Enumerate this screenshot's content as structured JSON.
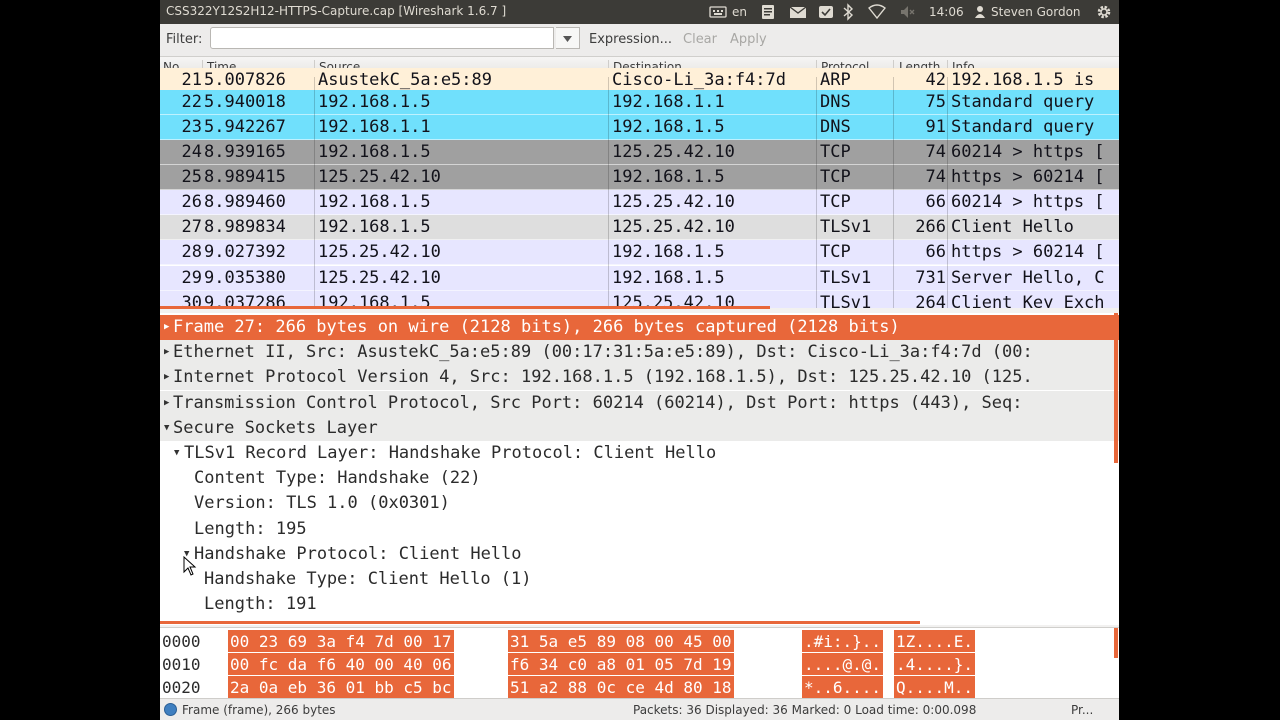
{
  "window": {
    "title": "CSS322Y12S2H12-HTTPS-Capture.cap   [Wireshark 1.6.7 ]",
    "tray": {
      "keyboard_layout": "en",
      "time": "14:06",
      "user": "Steven Gordon"
    }
  },
  "filter_bar": {
    "label": "Filter:",
    "value": "",
    "expression_label": "Expression...",
    "clear_label": "Clear",
    "apply_label": "Apply"
  },
  "packet_list": {
    "columns": [
      "No.",
      "Time",
      "Source",
      "Destination",
      "Protocol",
      "Length",
      "Info"
    ],
    "rows": [
      {
        "no": "21",
        "time": "5.007826",
        "src": "AsustekC_5a:e5:89",
        "dst": "Cisco-Li_3a:f4:7d",
        "proto": "ARP",
        "len": "42",
        "info": "192.168.1.5 is",
        "bg": "#fff0d8",
        "fg": "#12121a"
      },
      {
        "no": "22",
        "time": "5.940018",
        "src": "192.168.1.5",
        "dst": "192.168.1.1",
        "proto": "DNS",
        "len": "75",
        "info": "Standard query",
        "bg": "#70e0fc",
        "fg": "#12121a"
      },
      {
        "no": "23",
        "time": "5.942267",
        "src": "192.168.1.1",
        "dst": "192.168.1.5",
        "proto": "DNS",
        "len": "91",
        "info": "Standard query",
        "bg": "#70e0fc",
        "fg": "#12121a"
      },
      {
        "no": "24",
        "time": "8.939165",
        "src": "192.168.1.5",
        "dst": "125.25.42.10",
        "proto": "TCP",
        "len": "74",
        "info": "60214 > https [",
        "bg": "#a0a0a0",
        "fg": "#12121a"
      },
      {
        "no": "25",
        "time": "8.989415",
        "src": "125.25.42.10",
        "dst": "192.168.1.5",
        "proto": "TCP",
        "len": "74",
        "info": "https > 60214 [",
        "bg": "#a0a0a0",
        "fg": "#12121a"
      },
      {
        "no": "26",
        "time": "8.989460",
        "src": "192.168.1.5",
        "dst": "125.25.42.10",
        "proto": "TCP",
        "len": "66",
        "info": "60214 > https [",
        "bg": "#e7e6ff",
        "fg": "#12121a"
      },
      {
        "no": "27",
        "time": "8.989834",
        "src": "192.168.1.5",
        "dst": "125.25.42.10",
        "proto": "TLSv1",
        "len": "266",
        "info": "Client Hello",
        "bg": "#dedede",
        "fg": "#12121a"
      },
      {
        "no": "28",
        "time": "9.027392",
        "src": "125.25.42.10",
        "dst": "192.168.1.5",
        "proto": "TCP",
        "len": "66",
        "info": "https > 60214 [",
        "bg": "#e7e6ff",
        "fg": "#12121a"
      },
      {
        "no": "29",
        "time": "9.035380",
        "src": "125.25.42.10",
        "dst": "192.168.1.5",
        "proto": "TLSv1",
        "len": "731",
        "info": "Server Hello, C",
        "bg": "#e7e6ff",
        "fg": "#12121a"
      },
      {
        "no": "30",
        "time": "9.037286",
        "src": "192.168.1.5",
        "dst": "125.25.42.10",
        "proto": "TLSv1",
        "len": "264",
        "info": "Client Key Exch",
        "bg": "#e7e6ff",
        "fg": "#12121a"
      }
    ]
  },
  "details": {
    "items": [
      {
        "text": "Frame 27: 266 bytes on wire (2128 bits), 266 bytes captured (2128 bits)",
        "expanded": false,
        "selected": true,
        "level": 0,
        "has_children": true
      },
      {
        "text": "Ethernet II, Src: AsustekC_5a:e5:89 (00:17:31:5a:e5:89), Dst: Cisco-Li_3a:f4:7d (00:",
        "expanded": false,
        "selected": false,
        "level": 0,
        "has_children": true
      },
      {
        "text": "Internet Protocol Version 4, Src: 192.168.1.5 (192.168.1.5), Dst: 125.25.42.10 (125.",
        "expanded": false,
        "selected": false,
        "level": 0,
        "has_children": true
      },
      {
        "text": "Transmission Control Protocol, Src Port: 60214 (60214), Dst Port: https (443), Seq:",
        "expanded": false,
        "selected": false,
        "level": 0,
        "has_children": true
      },
      {
        "text": "Secure Sockets Layer",
        "expanded": true,
        "selected": false,
        "level": 0,
        "has_children": true
      },
      {
        "text": "TLSv1 Record Layer: Handshake Protocol: Client Hello",
        "expanded": true,
        "selected": false,
        "level": 1,
        "has_children": true
      },
      {
        "text": "Content Type: Handshake (22)",
        "expanded": false,
        "selected": false,
        "level": 2,
        "has_children": false
      },
      {
        "text": "Version: TLS 1.0 (0x0301)",
        "expanded": false,
        "selected": false,
        "level": 2,
        "has_children": false
      },
      {
        "text": "Length: 195",
        "expanded": false,
        "selected": false,
        "level": 2,
        "has_children": false
      },
      {
        "text": "Handshake Protocol: Client Hello",
        "expanded": true,
        "selected": false,
        "level": 2,
        "has_children": true
      },
      {
        "text": "Handshake Type: Client Hello (1)",
        "expanded": false,
        "selected": false,
        "level": 3,
        "has_children": false
      },
      {
        "text": "Length: 191",
        "expanded": false,
        "selected": false,
        "level": 3,
        "has_children": false
      }
    ]
  },
  "hex_dump": {
    "rows": [
      {
        "offset": "0000",
        "bytes1": "00 23 69 3a f4 7d 00 17",
        "bytes2": "31 5a e5 89 08 00 45 00",
        "ascii1": ".#i:.}..",
        "ascii2": "1Z....E."
      },
      {
        "offset": "0010",
        "bytes1": "00 fc da f6 40 00 40 06",
        "bytes2": "f6 34 c0 a8 01 05 7d 19",
        "ascii1": "....@.@.",
        "ascii2": ".4....}."
      },
      {
        "offset": "0020",
        "bytes1": "2a 0a eb 36 01 bb c5 bc",
        "bytes2": "51 a2 88 0c ce 4d 80 18",
        "ascii1": "*..6....",
        "ascii2": "Q....M.."
      }
    ]
  },
  "status_bar": {
    "left": "Frame (frame), 266 bytes",
    "packets": "Packets: 36 Displayed: 36 Marked: 0 Load time: 0:00.098",
    "profile": "Pr..."
  },
  "colors": {
    "selection": "#e8673a",
    "dns_row": "#70e0fc",
    "tcp_syn_row": "#a0a0a0",
    "tcp_row": "#e7e6ff",
    "tls_selected_row": "#dedede"
  }
}
